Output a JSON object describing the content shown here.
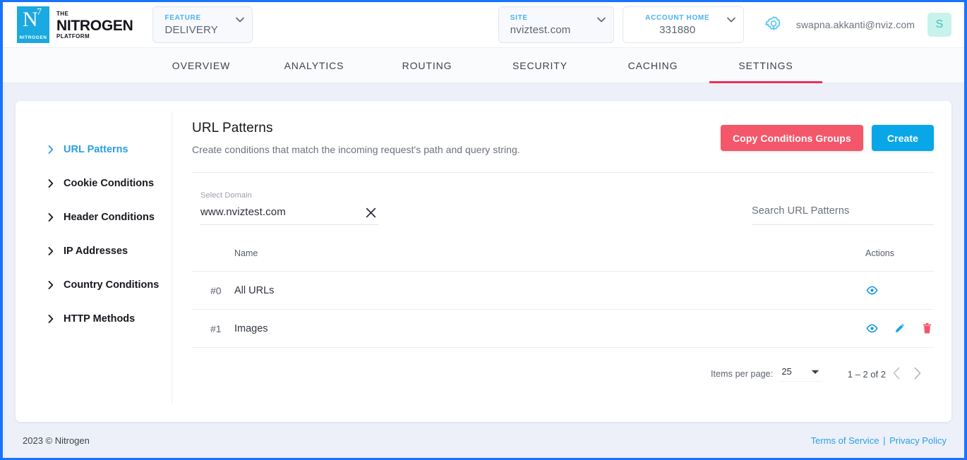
{
  "topbar": {
    "logo": {
      "letter": "N",
      "exp": "7",
      "mark_word": "NITROGEN",
      "the": "THE",
      "name": "NITROGEN",
      "platform": "PLATFORM"
    },
    "feature_select": {
      "label": "FEATURE",
      "value": "DELIVERY"
    },
    "site_select": {
      "label": "SITE",
      "value": "nviztest.com"
    },
    "account_select": {
      "label": "ACCOUNT HOME",
      "value": "331880"
    },
    "gear_icon": "gear-wrench-icon",
    "user_email": "swapna.akkanti@nviz.com",
    "avatar_initial": "S"
  },
  "nav": {
    "tabs": [
      {
        "label": "OVERVIEW",
        "active": false
      },
      {
        "label": "ANALYTICS",
        "active": false
      },
      {
        "label": "ROUTING",
        "active": false
      },
      {
        "label": "SECURITY",
        "active": false
      },
      {
        "label": "CACHING",
        "active": false
      },
      {
        "label": "SETTINGS",
        "active": true
      }
    ]
  },
  "sidebar": {
    "items": [
      {
        "label": "URL Patterns",
        "active": true
      },
      {
        "label": "Cookie Conditions",
        "active": false
      },
      {
        "label": "Header Conditions",
        "active": false
      },
      {
        "label": "IP Addresses",
        "active": false
      },
      {
        "label": "Country Conditions",
        "active": false
      },
      {
        "label": "HTTP Methods",
        "active": false
      }
    ]
  },
  "main": {
    "title": "URL Patterns",
    "subtitle": "Create conditions that match the incoming request's path and query string.",
    "copy_button": "Copy Conditions Groups",
    "create_button": "Create",
    "domain_field": {
      "label": "Select Domain",
      "value": "www.nviztest.com",
      "clear_icon": "close-x-icon"
    },
    "search_field": {
      "placeholder": "Search URL Patterns",
      "value": ""
    },
    "table": {
      "columns": [
        "",
        "Name",
        "Actions"
      ],
      "rows": [
        {
          "index": "#0",
          "name": "All URLs",
          "actions": [
            "view-icon"
          ]
        },
        {
          "index": "#1",
          "name": "Images",
          "actions": [
            "view-icon",
            "edit-icon",
            "delete-icon"
          ]
        }
      ]
    },
    "paginator": {
      "items_per_page_label": "Items per page:",
      "items_per_page_value": "25",
      "range_label": "1 – 2 of 2",
      "prev_icon": "chevron-left-icon",
      "next_icon": "chevron-right-icon"
    }
  },
  "footer": {
    "copyright": "2023 © Nitrogen",
    "terms": "Terms of Service",
    "separator": "|",
    "privacy": "Privacy Policy"
  },
  "colors": {
    "accent_blue": "#0aa7e8",
    "accent_red": "#f4576a",
    "active_tab_underline": "#f02f58",
    "link_blue": "#2b9fe5",
    "page_bg": "#edf0f9",
    "avatar_bg": "#c8f2ec"
  }
}
